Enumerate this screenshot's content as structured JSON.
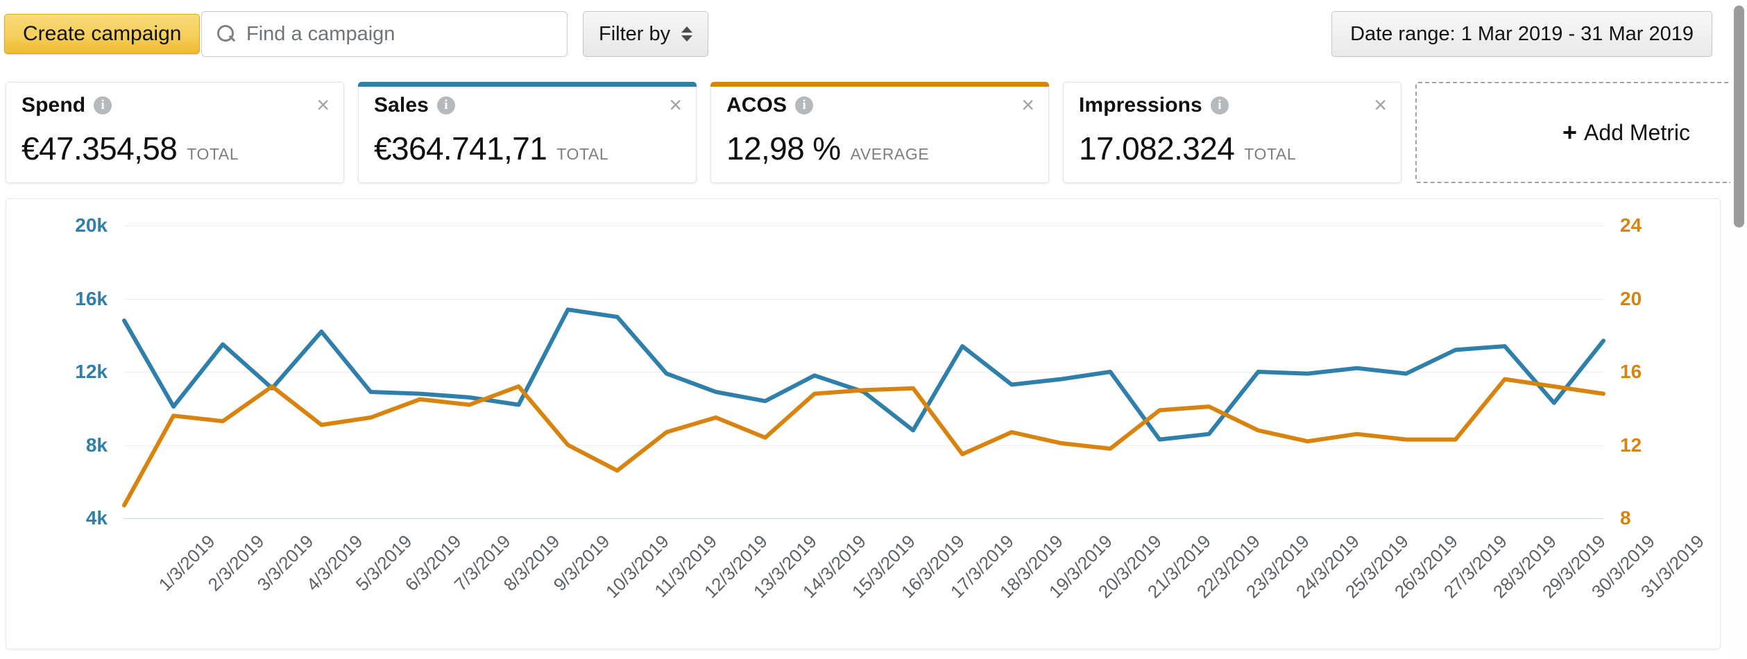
{
  "toolbar": {
    "create_label": "Create campaign",
    "search_placeholder": "Find a campaign",
    "search_value": "",
    "filter_label": "Filter by",
    "date_range_label": "Date range: 1 Mar 2019 - 31 Mar 2019"
  },
  "metric_cards": [
    {
      "title": "Spend",
      "value": "€47.354,58",
      "unit": "TOTAL",
      "accent": "none",
      "close": "×"
    },
    {
      "title": "Sales",
      "value": "€364.741,71",
      "unit": "TOTAL",
      "accent": "#2f7fab",
      "close": "×"
    },
    {
      "title": "ACOS",
      "value": "12,98 %",
      "unit": "AVERAGE",
      "accent": "#d9830f",
      "close": "×"
    },
    {
      "title": "Impressions",
      "value": "17.082.324",
      "unit": "TOTAL",
      "accent": "none",
      "close": "×"
    }
  ],
  "add_metric": {
    "plus": "+",
    "label": "Add Metric"
  },
  "colors": {
    "sales_blue": "#2f7fab",
    "acos_orange": "#d9830f",
    "create_button": "#f2c64a",
    "grid": "#ececee"
  },
  "chart_data": {
    "type": "line",
    "title": "",
    "xlabel": "",
    "grid": true,
    "legend": "none",
    "x": [
      "1/3/2019",
      "2/3/2019",
      "3/3/2019",
      "4/3/2019",
      "5/3/2019",
      "6/3/2019",
      "7/3/2019",
      "8/3/2019",
      "9/3/2019",
      "10/3/2019",
      "11/3/2019",
      "12/3/2019",
      "13/3/2019",
      "14/3/2019",
      "15/3/2019",
      "16/3/2019",
      "17/3/2019",
      "18/3/2019",
      "19/3/2019",
      "20/3/2019",
      "21/3/2019",
      "22/3/2019",
      "23/3/2019",
      "24/3/2019",
      "25/3/2019",
      "26/3/2019",
      "27/3/2019",
      "28/3/2019",
      "29/3/2019",
      "30/3/2019",
      "31/3/2019"
    ],
    "left_axis": {
      "label": "Sales",
      "ticks": [
        "4k",
        "8k",
        "12k",
        "16k",
        "20k"
      ],
      "values": [
        4000,
        8000,
        12000,
        16000,
        20000
      ],
      "min": 4000,
      "max": 20000,
      "color": "#2f7fab"
    },
    "right_axis": {
      "label": "ACOS",
      "ticks": [
        "8",
        "12",
        "16",
        "20",
        "24"
      ],
      "values": [
        8,
        12,
        16,
        20,
        24
      ],
      "min": 8,
      "max": 24,
      "color": "#d9830f"
    },
    "series": [
      {
        "name": "Sales",
        "axis": "left",
        "color": "#2f7fab",
        "values": [
          14800,
          10100,
          13500,
          11100,
          14200,
          10900,
          10800,
          10600,
          10200,
          15400,
          15000,
          11900,
          10900,
          10400,
          11800,
          10900,
          8800,
          13400,
          11300,
          11600,
          12000,
          8300,
          8600,
          12000,
          11900,
          12200,
          11900,
          13200,
          13400,
          10300,
          13700
        ]
      },
      {
        "name": "ACOS",
        "axis": "right",
        "color": "#d9830f",
        "values": [
          8.7,
          13.6,
          13.3,
          15.2,
          13.1,
          13.5,
          14.5,
          14.2,
          15.2,
          12.0,
          10.6,
          12.7,
          13.5,
          12.4,
          14.8,
          15.0,
          15.1,
          11.5,
          12.7,
          12.1,
          11.8,
          13.9,
          14.1,
          12.8,
          12.2,
          12.6,
          12.3,
          12.3,
          15.6,
          15.2,
          14.8
        ]
      }
    ]
  }
}
